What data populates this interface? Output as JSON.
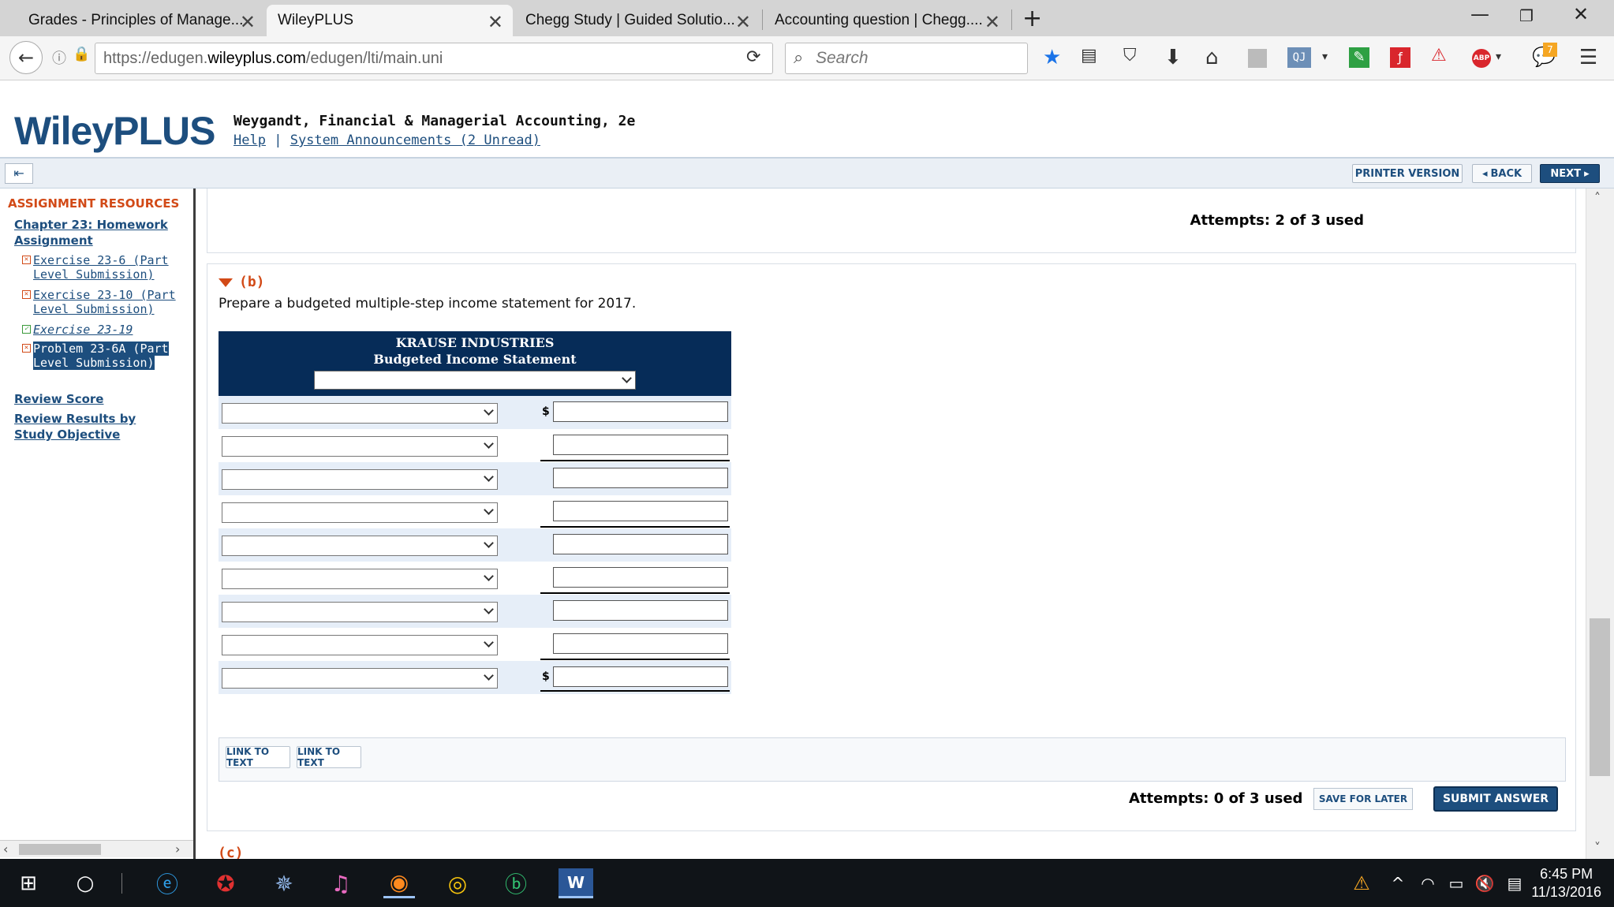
{
  "browser": {
    "tabs": [
      {
        "title": "Grades - Principles of Manage...",
        "active": false
      },
      {
        "title": "WileyPLUS",
        "active": true
      },
      {
        "title": "Chegg Study | Guided Solutio...",
        "active": false
      },
      {
        "title": "Accounting question | Chegg....",
        "active": false
      }
    ],
    "new_tab": "+",
    "url_prefix": "https://edugen.",
    "url_host": "wileyplus.com",
    "url_path": "/edugen/lti/main.uni",
    "search_placeholder": "Search",
    "badge_count": "7"
  },
  "header": {
    "logo": "WileyPLUS",
    "course_title": "Weygandt, Financial & Managerial Accounting, 2e",
    "help_link": "Help",
    "separator": "|",
    "announcements_link": "System Announcements (2 Unread)"
  },
  "toolbar": {
    "printer": "PRINTER VERSION",
    "back": "BACK",
    "next": "NEXT"
  },
  "sidebar": {
    "title": "ASSIGNMENT RESOURCES",
    "chapter_link": "Chapter 23: Homework Assignment",
    "items": [
      {
        "label": "Exercise 23-6 (Part Level Submission)",
        "status": "incomplete"
      },
      {
        "label": "Exercise 23-10 (Part Level Submission)",
        "status": "incomplete"
      },
      {
        "label": "Exercise 23-19",
        "status": "complete"
      },
      {
        "label": "Problem 23-6A (Part Level Submission)",
        "status": "incomplete",
        "selected": true
      }
    ],
    "review_score": "Review Score",
    "review_results": "Review Results by Study Objective"
  },
  "part_a": {
    "attempts": "Attempts: 2 of 3 used"
  },
  "part_b": {
    "label": "(b)",
    "instruction": "Prepare a budgeted multiple-step income statement for 2017.",
    "company": "KRAUSE INDUSTRIES",
    "statement_title": "Budgeted Income Statement",
    "currency_symbol": "$",
    "link_to_text_1": "LINK TO TEXT",
    "link_to_text_2": "LINK TO TEXT",
    "attempts": "Attempts: 0 of 3 used",
    "save_for_later": "SAVE FOR LATER",
    "submit": "SUBMIT ANSWER"
  },
  "part_c": {
    "label": "(c)"
  },
  "taskbar": {
    "time": "6:45 PM",
    "date": "11/13/2016"
  }
}
